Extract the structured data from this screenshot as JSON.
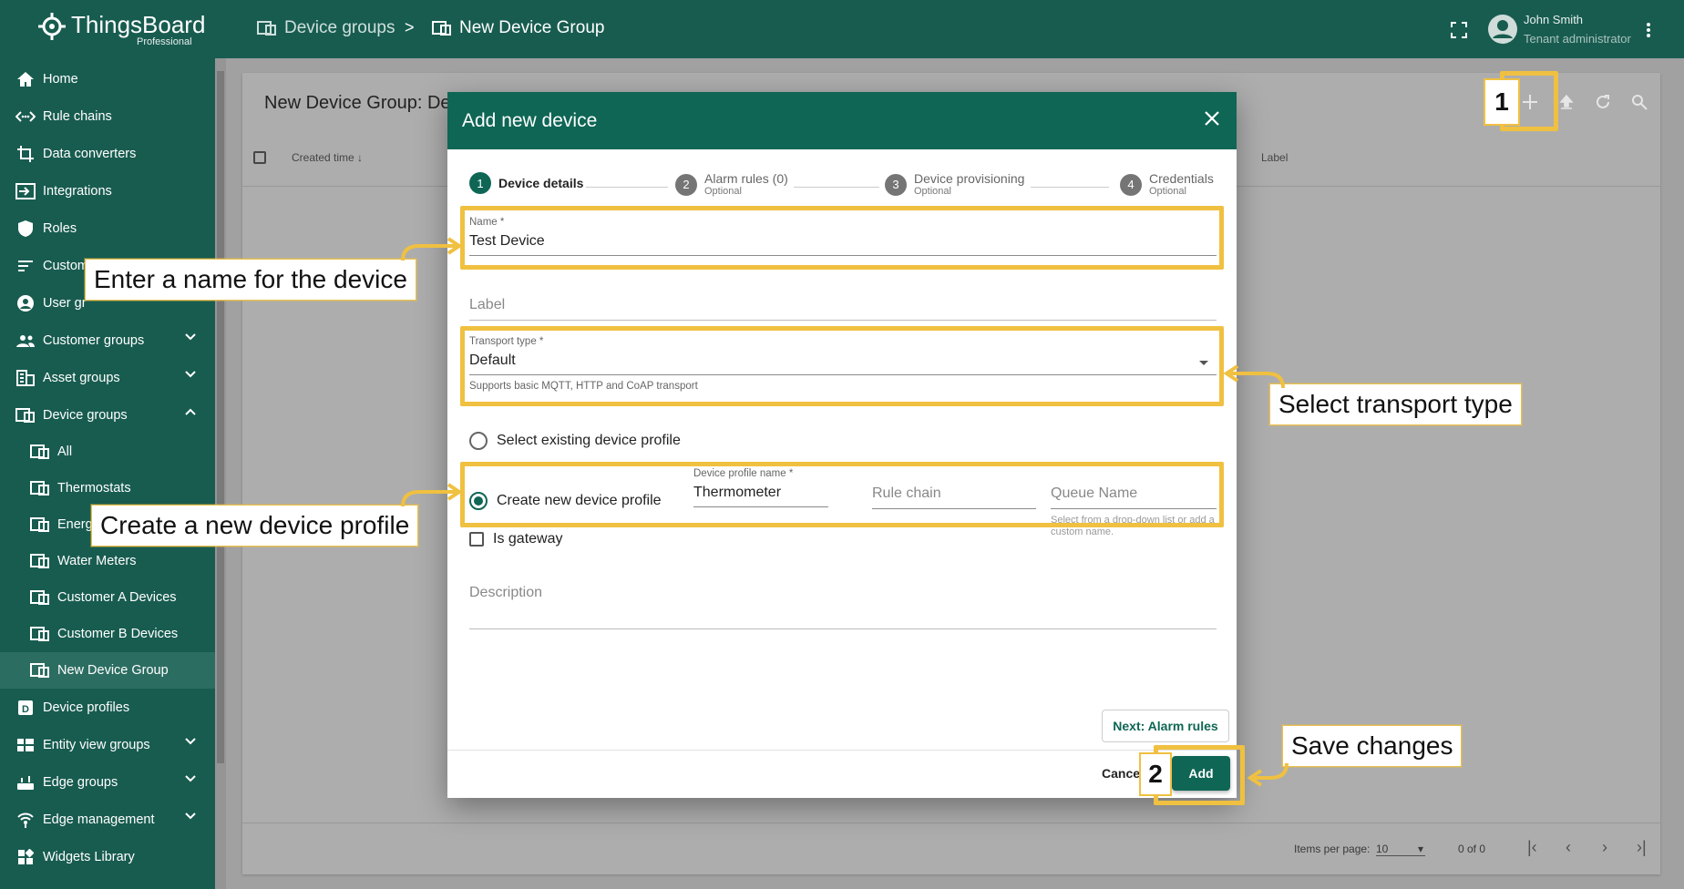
{
  "app": {
    "brand": "ThingsBoard",
    "brand_sub": "Professional"
  },
  "header": {
    "breadcrumb_parent": "Device groups",
    "breadcrumb_sep": ">",
    "breadcrumb_current": "New Device Group",
    "user_name": "John Smith",
    "user_role": "Tenant administrator"
  },
  "sidebar": {
    "items": [
      {
        "label": "Home",
        "icon": "home-icon"
      },
      {
        "label": "Rule chains",
        "icon": "rule-chain-icon"
      },
      {
        "label": "Data converters",
        "icon": "converter-icon"
      },
      {
        "label": "Integrations",
        "icon": "integration-icon"
      },
      {
        "label": "Roles",
        "icon": "shield-icon"
      },
      {
        "label": "Custom",
        "icon": "customers-icon"
      },
      {
        "label": "User gr",
        "icon": "user-group-icon"
      },
      {
        "label": "Customer groups",
        "icon": "customer-groups-icon"
      },
      {
        "label": "Asset groups",
        "icon": "asset-groups-icon"
      },
      {
        "label": "Device groups",
        "icon": "device-groups-icon"
      },
      {
        "label": "All",
        "icon": "device-icon"
      },
      {
        "label": "Thermostats",
        "icon": "device-icon"
      },
      {
        "label": "Energ",
        "icon": "device-icon"
      },
      {
        "label": "Water Meters",
        "icon": "device-icon"
      },
      {
        "label": "Customer A Devices",
        "icon": "device-icon"
      },
      {
        "label": "Customer B Devices",
        "icon": "device-icon"
      },
      {
        "label": "New Device Group",
        "icon": "device-icon"
      },
      {
        "label": "Device profiles",
        "icon": "device-profile-icon"
      },
      {
        "label": "Entity view groups",
        "icon": "entity-view-icon"
      },
      {
        "label": "Edge groups",
        "icon": "edge-icon"
      },
      {
        "label": "Edge management",
        "icon": "edge-management-icon"
      },
      {
        "label": "Widgets Library",
        "icon": "widgets-icon"
      }
    ]
  },
  "panel": {
    "title": "New Device Group: De",
    "col_created": "Created time",
    "col_label": "Label",
    "items_per_page_label": "Items per page:",
    "items_per_page": "10",
    "range": "0 of 0"
  },
  "dialog": {
    "title": "Add new device",
    "steps": [
      {
        "num": "1",
        "label": "Device details",
        "optional": ""
      },
      {
        "num": "2",
        "label": "Alarm rules (0)",
        "optional": "Optional"
      },
      {
        "num": "3",
        "label": "Device provisioning",
        "optional": "Optional"
      },
      {
        "num": "4",
        "label": "Credentials",
        "optional": "Optional"
      }
    ],
    "name_label": "Name *",
    "name_value": "Test Device",
    "label_placeholder": "Label",
    "transport_label": "Transport type *",
    "transport_value": "Default",
    "transport_hint": "Supports basic MQTT, HTTP and CoAP transport",
    "select_existing": "Select existing device profile",
    "create_new": "Create new device profile",
    "profile_name_label": "Device profile name *",
    "profile_name_value": "Thermometer",
    "rule_chain_placeholder": "Rule chain",
    "queue_name_placeholder": "Queue Name",
    "queue_hint": "Select from a drop-down list or add a custom name.",
    "is_gateway": "Is gateway",
    "description_placeholder": "Description",
    "next_button": "Next: Alarm rules",
    "cancel_button": "Cancel",
    "add_button": "Add"
  },
  "annotations": {
    "badge_1": "1",
    "badge_2": "2",
    "callout_name": "Enter a name for the device",
    "callout_transport": "Select transport type",
    "callout_profile": "Create a new device profile",
    "callout_save": "Save changes",
    "highlight_color": "#f0c040"
  },
  "colors": {
    "primary": "#185c50",
    "dialog_header": "#0f6655"
  }
}
